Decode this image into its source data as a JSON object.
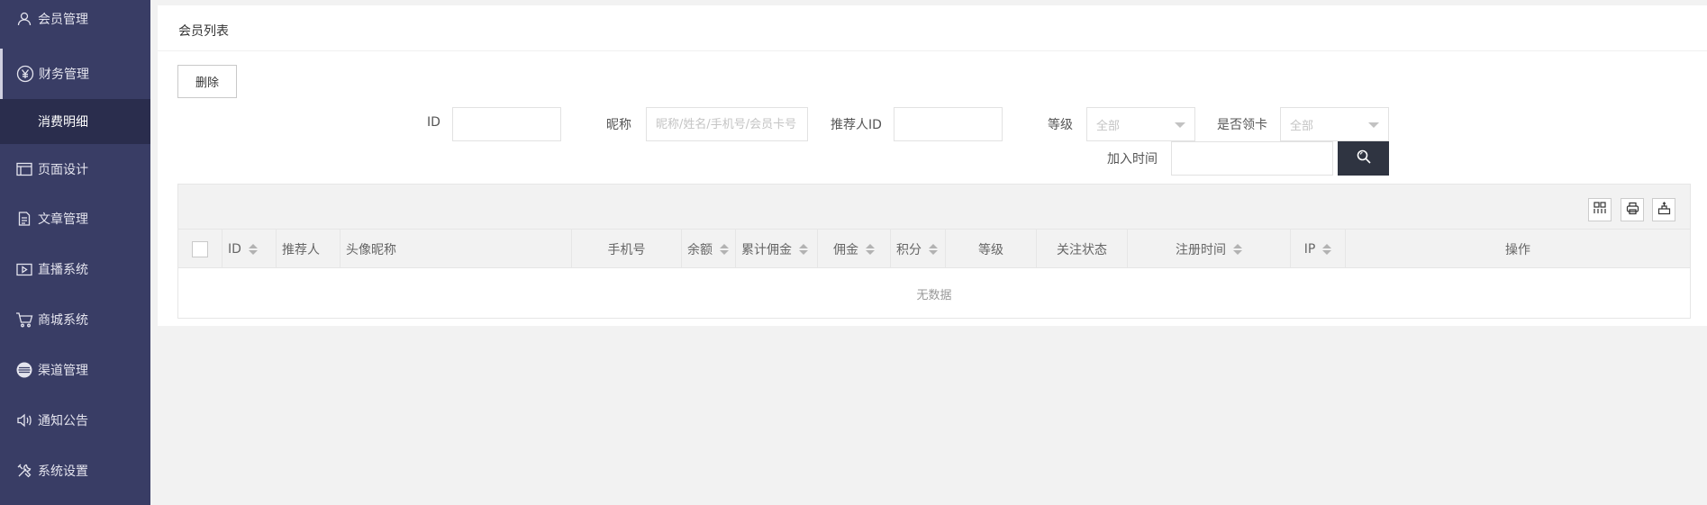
{
  "sidebar": {
    "items": [
      {
        "label": "会员管理",
        "icon": "user-icon"
      },
      {
        "label": "财务管理",
        "icon": "yen-icon"
      },
      {
        "label": "页面设计",
        "icon": "layout-icon"
      },
      {
        "label": "文章管理",
        "icon": "document-icon"
      },
      {
        "label": "直播系统",
        "icon": "video-icon"
      },
      {
        "label": "商城系统",
        "icon": "cart-icon"
      },
      {
        "label": "渠道管理",
        "icon": "channel-icon"
      },
      {
        "label": "通知公告",
        "icon": "speaker-icon"
      },
      {
        "label": "系统设置",
        "icon": "tools-icon"
      }
    ],
    "sub_item": {
      "label": "消费明细"
    }
  },
  "panel": {
    "title": "会员列表"
  },
  "toolbar": {
    "delete_label": "删除"
  },
  "filters": {
    "id_label": "ID",
    "id_value": "",
    "nickname_label": "昵称",
    "nickname_placeholder": "昵称/姓名/手机号/会员卡号",
    "referrer_label": "推荐人ID",
    "referrer_value": "",
    "level_label": "等级",
    "level_selected": "全部",
    "card_label": "是否领卡",
    "card_selected": "全部",
    "join_time_label": "加入时间",
    "join_time_value": ""
  },
  "table": {
    "columns": {
      "id": "ID",
      "referrer": "推荐人",
      "avatar_nickname": "头像昵称",
      "phone": "手机号",
      "balance": "余额",
      "total_commission": "累计佣金",
      "commission": "佣金",
      "points": "积分",
      "level": "等级",
      "follow_status": "关注状态",
      "register_time": "注册时间",
      "ip": "IP",
      "actions": "操作"
    },
    "empty_text": "无数据"
  },
  "colors": {
    "sidebar_bg": "#393d65",
    "sidebar_active_bg": "#2a2d4d",
    "search_button_bg": "#2f3441"
  }
}
